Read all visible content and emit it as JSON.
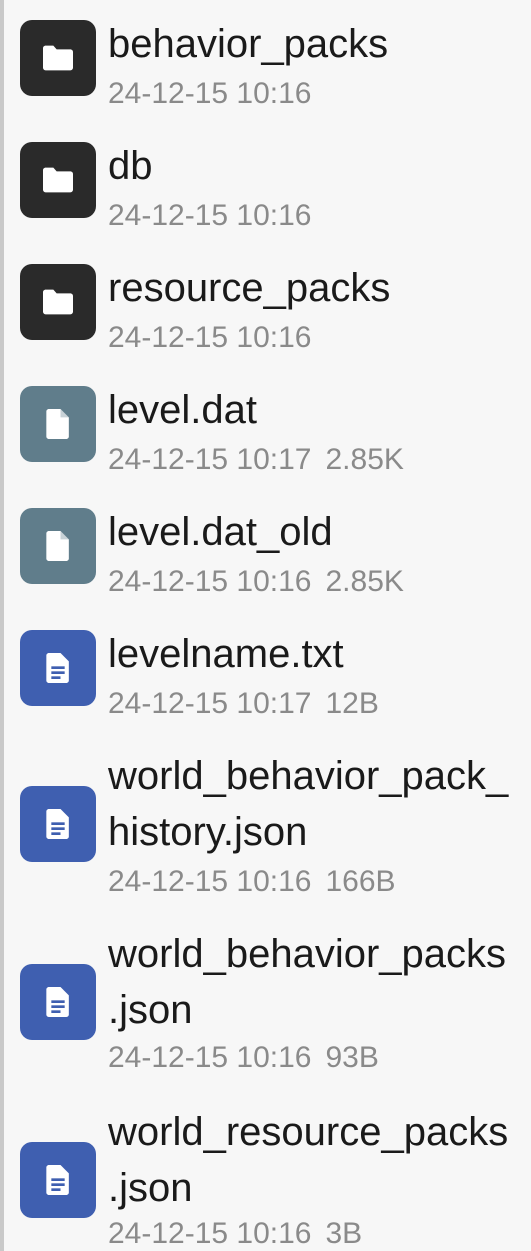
{
  "files": [
    {
      "name": "behavior_packs",
      "kind": "folder",
      "icon": "folder-icon",
      "modified": "24-12-15 10:16",
      "size": ""
    },
    {
      "name": "db",
      "kind": "folder",
      "icon": "folder-icon",
      "modified": "24-12-15 10:16",
      "size": ""
    },
    {
      "name": "resource_packs",
      "kind": "folder",
      "icon": "folder-icon",
      "modified": "24-12-15 10:16",
      "size": ""
    },
    {
      "name": "level.dat",
      "kind": "binary",
      "icon": "file-icon",
      "modified": "24-12-15 10:17",
      "size": "2.85K"
    },
    {
      "name": "level.dat_old",
      "kind": "binary",
      "icon": "file-icon",
      "modified": "24-12-15 10:16",
      "size": "2.85K"
    },
    {
      "name": "levelname.txt",
      "kind": "text",
      "icon": "text-file-icon",
      "modified": "24-12-15 10:17",
      "size": "12B"
    },
    {
      "name": "world_behavior_pack_\nhistory.json",
      "kind": "text",
      "icon": "text-file-icon",
      "modified": "24-12-15 10:16",
      "size": "166B"
    },
    {
      "name": "world_behavior_packs\n.json",
      "kind": "text",
      "icon": "text-file-icon",
      "modified": "24-12-15 10:16",
      "size": "93B"
    },
    {
      "name": "world_resource_packs\n.json",
      "kind": "text",
      "icon": "text-file-icon",
      "modified": "24-12-15 10:16",
      "size": "3B"
    }
  ],
  "colors": {
    "folder_icon_bg": "#2a2a2a",
    "binary_icon_bg": "#607d8b",
    "text_icon_bg": "#3f5fb0"
  }
}
